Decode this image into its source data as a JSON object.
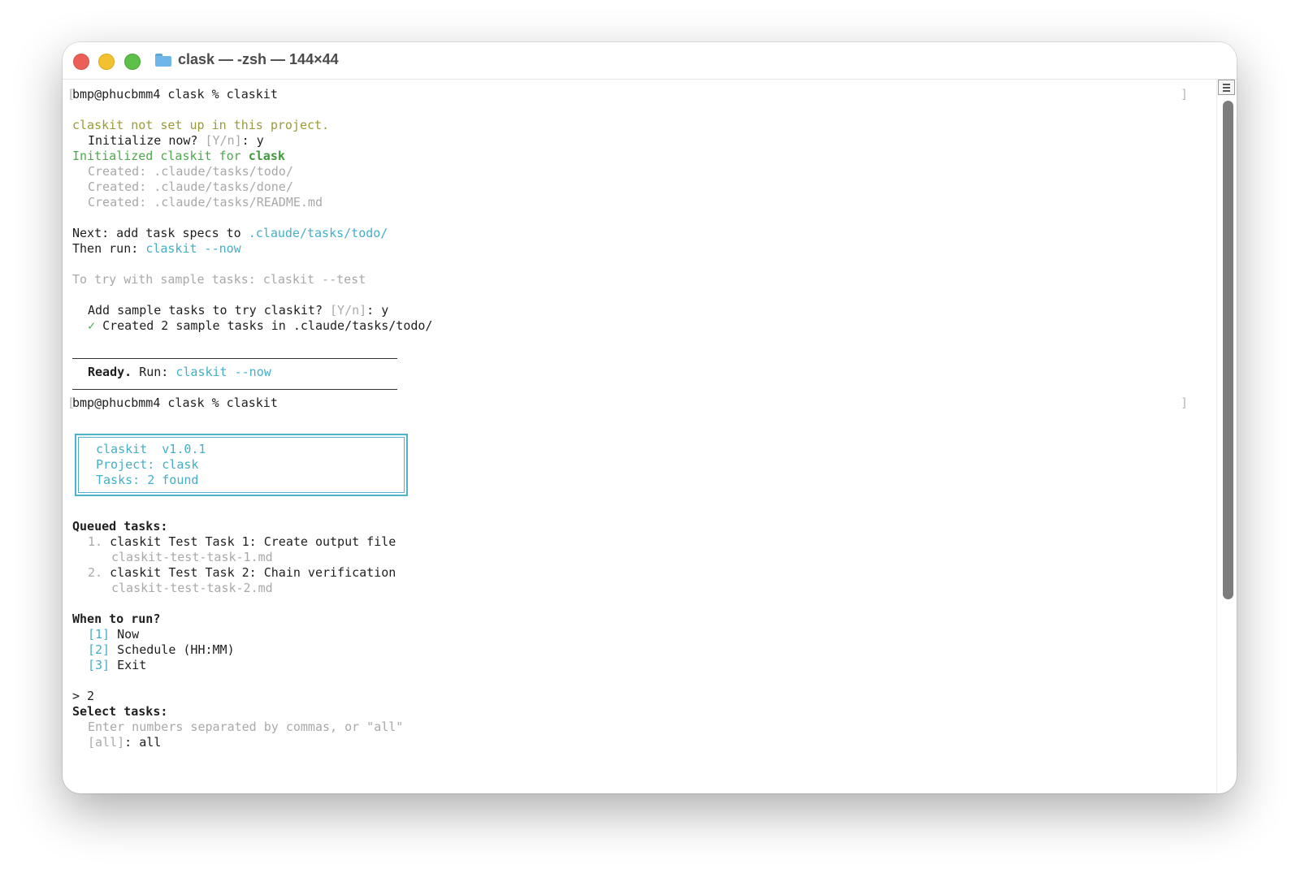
{
  "window": {
    "title": "clask — -zsh — 144×44"
  },
  "terminal": {
    "prompt1": "bmp@phucbmm4 clask % claskit",
    "not_setup": "claskit not set up in this project.",
    "init_q_prefix": "Initialize now?",
    "init_q_opts": "[Y/n]",
    "init_q_answer": ": y",
    "initialized_prefix": "Initialized claskit for",
    "initialized_project": "clask",
    "created": [
      "Created: .claude/tasks/todo/",
      "Created: .claude/tasks/done/",
      "Created: .claude/tasks/README.md"
    ],
    "next_prefix": "Next: add task specs to",
    "next_path": ".claude/tasks/todo/",
    "then_prefix": "Then run:",
    "then_cmd": "claskit --now",
    "try_sample": "To try with sample tasks: claskit --test",
    "sample_q_prefix": "Add sample tasks to try claskit?",
    "sample_q_opts": "[Y/n]",
    "sample_q_answer": ": y",
    "check": "✓",
    "sample_created": "Created 2 sample tasks in .claude/tasks/todo/",
    "ready_label": "Ready.",
    "ready_run": "Run:",
    "ready_cmd": "claskit --now",
    "prompt2": "bmp@phucbmm4 clask % claskit",
    "box": {
      "line1": "claskit  v1.0.1",
      "line2": "Project: clask",
      "line3": "Tasks: 2 found"
    },
    "queued_heading": "Queued tasks:",
    "tasks": [
      {
        "num": "1.",
        "title": "claskit Test Task 1: Create output file",
        "file": "claskit-test-task-1.md"
      },
      {
        "num": "2.",
        "title": "claskit Test Task 2: Chain verification",
        "file": "claskit-test-task-2.md"
      }
    ],
    "when_heading": "When to run?",
    "options": [
      {
        "key": "[1]",
        "label": "Now"
      },
      {
        "key": "[2]",
        "label": "Schedule (HH:MM)"
      },
      {
        "key": "[3]",
        "label": "Exit"
      }
    ],
    "answer": "> 2",
    "select_heading": "Select tasks:",
    "select_hint": "Enter numbers separated by commas, or \"all\"",
    "select_default": "[all]",
    "select_answer": ": all"
  },
  "icons": {
    "folder": "folder-icon",
    "scroll_button": "scroll-marks-icon"
  },
  "colors": {
    "cyan": "#45aec8",
    "green": "#50a84e",
    "olive": "#9a9a3a",
    "gray": "#a9a9a9"
  }
}
